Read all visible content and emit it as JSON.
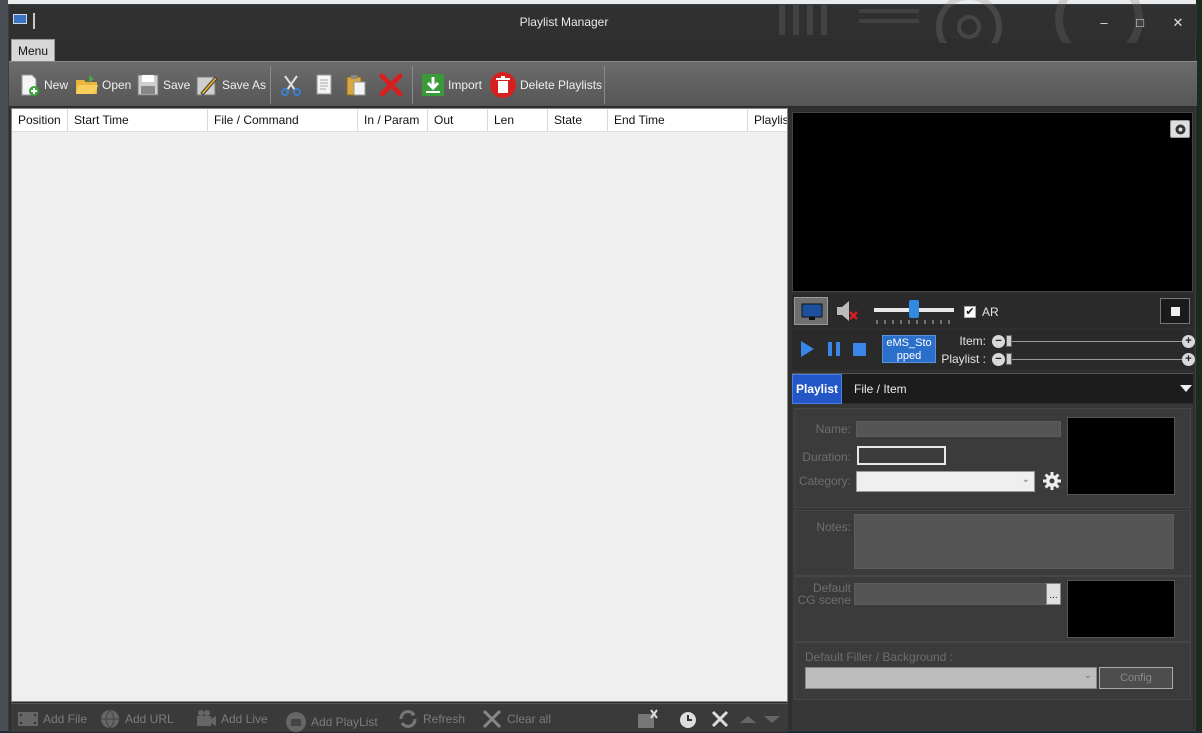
{
  "window": {
    "title": "Playlist Manager",
    "minimize_label": "–",
    "maximize_label": "□",
    "close_label": "✕"
  },
  "menu": {
    "label": "Menu"
  },
  "toolbar": {
    "new": "New",
    "open": "Open",
    "save": "Save",
    "save_as": "Save As",
    "import": "Import",
    "delete_playlists": "Delete Playlists"
  },
  "table": {
    "columns": [
      "Position",
      "Start Time",
      "File / Command",
      "In / Param",
      "Out",
      "Len",
      "State",
      "End Time",
      "Playlist"
    ]
  },
  "bottom_toolbar": {
    "add_file": "Add File",
    "add_url": "Add URL",
    "add_live": "Add Live",
    "add_playlist": "Add PlayList",
    "refresh": "Refresh",
    "clear_all": "Clear all"
  },
  "player": {
    "ar_label": "AR",
    "ar_checked": true,
    "ar_mark": "✔",
    "volume_level": 0.5,
    "state_line1": "eMS_Sto",
    "state_line2": "pped",
    "item_label": "Item:",
    "playlist_label": "Playlist :",
    "minus": "−",
    "plus": "+"
  },
  "tabs": {
    "playlist": "Playlist",
    "file_item": "File / Item"
  },
  "properties": {
    "name_label": "Name:",
    "duration_label": "Duration:",
    "category_label": "Category:",
    "notes_label": "Notes:",
    "cg_label_line1": "Default",
    "cg_label_line2": "CG scene",
    "cg_browse": "...",
    "filler_label": "Default Filler / Background :",
    "config_button": "Config",
    "dropdown_arrow": "⌄"
  },
  "colors": {
    "accent_blue": "#2357c7",
    "state_blue": "#2a6fc9",
    "import_green": "#3a9a3a",
    "delete_red": "#d62020"
  }
}
